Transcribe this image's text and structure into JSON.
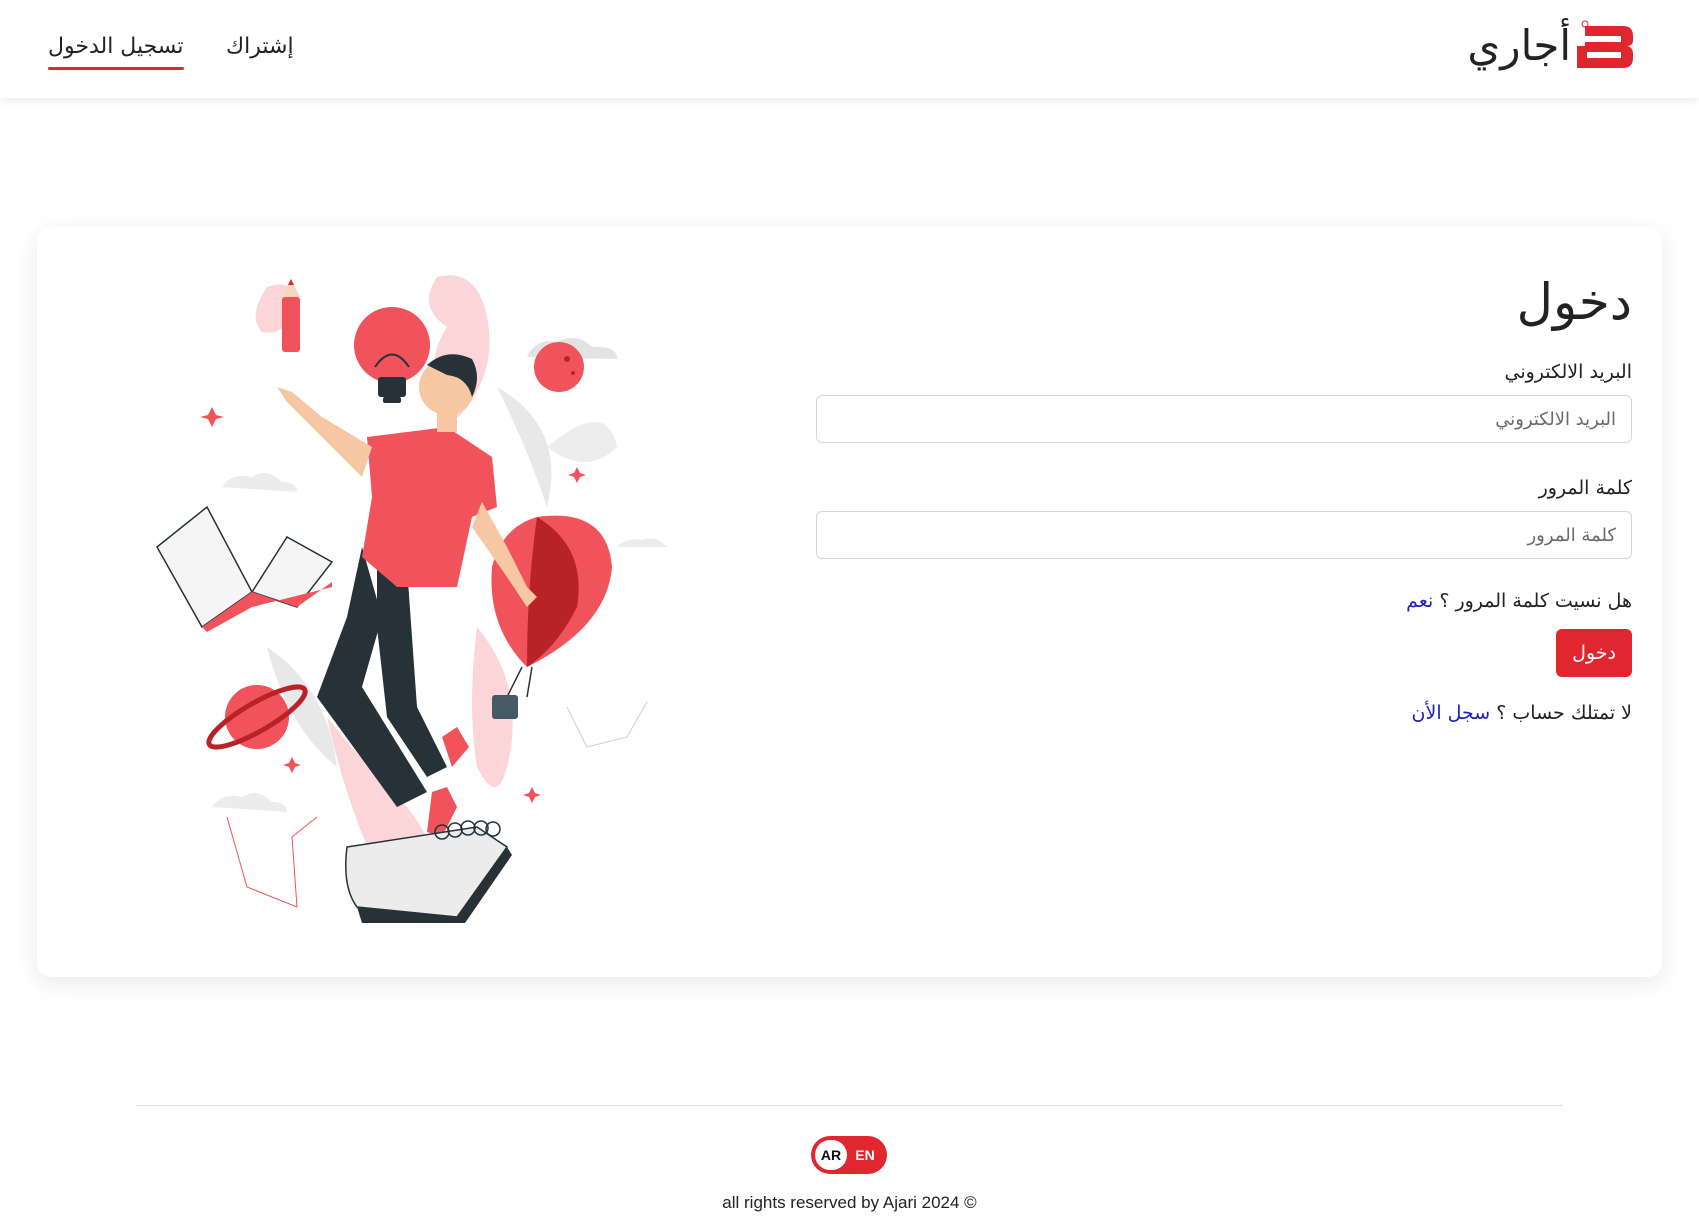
{
  "colors": {
    "accent": "#e0262f",
    "link": "#1f1fbf",
    "text": "#222222"
  },
  "header": {
    "logo_text": "أجاري",
    "logo_icon": "ajari-logo-icon",
    "nav": {
      "login": "تسجيل الدخول",
      "signup": "إشتراك"
    }
  },
  "login": {
    "title": "دخول",
    "email_label": "البريد الالكتروني",
    "email_placeholder": "البريد الالكتروني",
    "email_value": "",
    "password_label": "كلمة المرور",
    "password_placeholder": "كلمة المرور",
    "password_value": "",
    "forgot_text": "هل نسيت كلمة المرور ؟",
    "forgot_link": "نعم",
    "submit_label": "دخول",
    "no_account_text": "لا تمتلك حساب ؟",
    "register_link": "سجل الأن"
  },
  "footer": {
    "lang_active": "AR",
    "lang_other": "EN",
    "copyright": "all rights reserved by Ajari 2024 ©"
  }
}
